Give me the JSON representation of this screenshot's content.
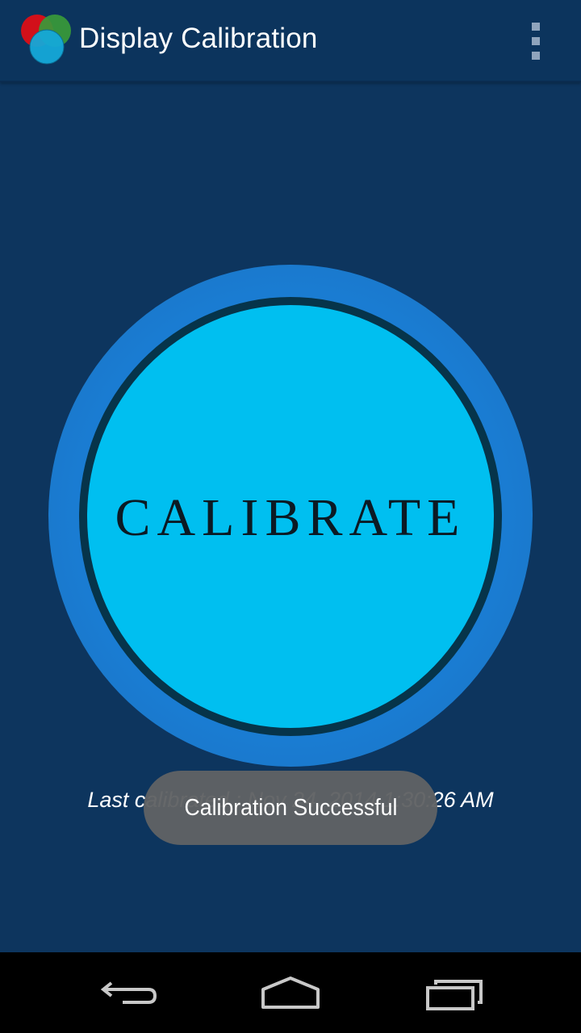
{
  "action_bar": {
    "title": "Display Calibration",
    "app_icon": "rgb-circles-icon",
    "overflow_icon": "overflow-menu-icon"
  },
  "main": {
    "calibrate_label": "CALIBRATE",
    "last_calibrated": "Last calibrated : Nov 24, 2014 1:30:26 AM"
  },
  "toast": {
    "message": "Calibration Successful"
  },
  "nav_bar": {
    "back_icon": "back-icon",
    "home_icon": "home-icon",
    "recents_icon": "recent-apps-icon"
  },
  "colors": {
    "background": "#0d355e",
    "button_fill": "#00bff0",
    "button_glow": "#1a7fd6",
    "toast_bg": "#606264"
  }
}
